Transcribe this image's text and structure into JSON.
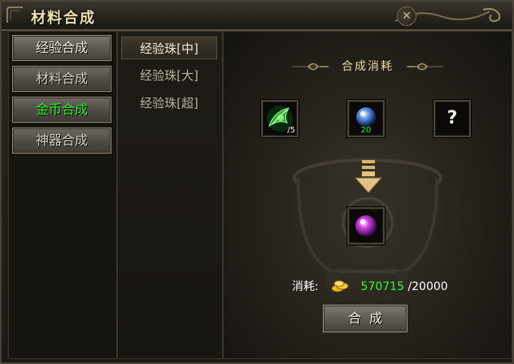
{
  "window": {
    "title": "材料合成",
    "close_glyph": "✕"
  },
  "categories": [
    {
      "label": "经验合成",
      "state": "active"
    },
    {
      "label": "材料合成",
      "state": "normal"
    },
    {
      "label": "金币合成",
      "state": "highlight"
    },
    {
      "label": "神器合成",
      "state": "normal"
    }
  ],
  "sub_items": [
    {
      "label": "经验珠[中]",
      "state": "selected"
    },
    {
      "label": "经验珠[大]",
      "state": "normal"
    },
    {
      "label": "经验珠[超]",
      "state": "normal"
    }
  ],
  "recipe": {
    "section_title": "合成消耗",
    "materials": [
      {
        "icon": "green-leaf-crystal-icon",
        "count": "/5",
        "count_color": "#ffffff"
      },
      {
        "icon": "blue-orb-icon",
        "count": "20",
        "count_color": "#30ff30"
      },
      {
        "icon": "unknown-question-icon",
        "count": "",
        "glyph": "?"
      }
    ],
    "result": {
      "icon": "purple-orb-icon"
    },
    "cost": {
      "label": "消耗:",
      "currency_icon": "gold-coins-icon",
      "owned": "570715",
      "required": "/20000"
    },
    "compose_button": "合成"
  },
  "colors": {
    "highlight_green": "#30ff30",
    "title_gold": "#f0e0b0",
    "panel_border": "#4a4236"
  }
}
